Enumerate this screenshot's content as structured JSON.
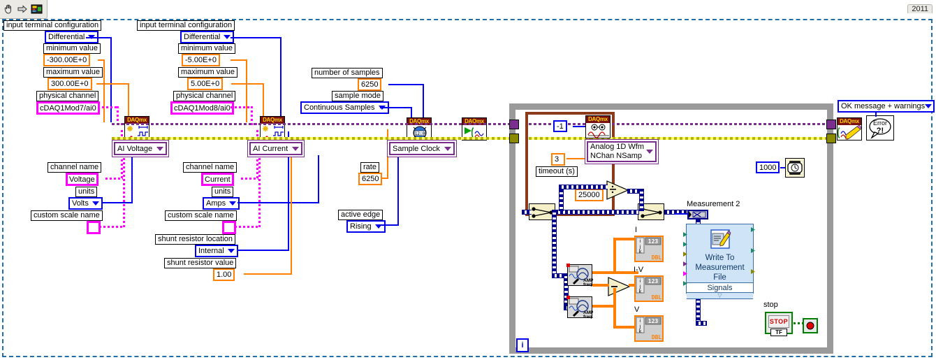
{
  "window": {
    "year_tab": "2011",
    "toolbar_icons": [
      "hand-tool-icon",
      "arrow-tool-icon",
      "block-diagram-icon"
    ]
  },
  "voltage_channel": {
    "terminal_config_label": "input terminal configuration",
    "terminal_config_value": "Differential",
    "min_label": "minimum value",
    "min_value": "-300.00E+0",
    "max_label": "maximum value",
    "max_value": "300.00E+0",
    "physical_channel_label": "physical channel",
    "physical_channel_value": "cDAQ1Mod7/ai0",
    "node_title": "DAQmx",
    "node_selector": "AI Voltage",
    "channel_name_label": "channel name",
    "channel_name_value": "Voltage",
    "units_label": "units",
    "units_value": "Volts",
    "custom_scale_label": "custom scale name",
    "custom_scale_value": ""
  },
  "current_channel": {
    "terminal_config_label": "input terminal configuration",
    "terminal_config_value": "Differential",
    "min_label": "minimum value",
    "min_value": "-5.00E+0",
    "max_label": "maximum value",
    "max_value": "5.00E+0",
    "physical_channel_label": "physical channel",
    "physical_channel_value": "cDAQ1Mod8/ai0",
    "node_title": "DAQmx",
    "node_selector": "AI Current",
    "channel_name_label": "channel name",
    "channel_name_value": "Current",
    "units_label": "units",
    "units_value": "Amps",
    "custom_scale_label": "custom scale name",
    "custom_scale_value": "",
    "shunt_location_label": "shunt resistor location",
    "shunt_location_value": "Internal",
    "shunt_value_label": "shunt resistor value",
    "shunt_value_value": "1.00"
  },
  "timing": {
    "number_of_samples_label": "number of samples",
    "number_of_samples_value": "6250",
    "sample_mode_label": "sample mode",
    "sample_mode_value": "Continuous Samples",
    "node_title": "DAQmx",
    "node_selector": "Sample Clock",
    "rate_label": "rate",
    "rate_value": "6250",
    "active_edge_label": "active edge",
    "active_edge_value": "Rising"
  },
  "start_task": {
    "node_title": "DAQmx"
  },
  "read": {
    "node_title": "DAQmx",
    "samples_value": "-1",
    "timeout_value": "3",
    "timeout_label": "timeout (s)",
    "node_selector_line1": "Analog 1D Wfm",
    "node_selector_line2": "NChan NSamp"
  },
  "loop": {
    "iteration_terminal": "i",
    "divisor_value": "25000",
    "wait_value": "1000",
    "wait_icon": "wait-ms-timer-icon",
    "divide_icon": "divide-operator-icon",
    "subtract_icon": "subtract-operator-icon",
    "merge_icon": "merge-signals-icon",
    "amp_freq_icon": "amplitude-and-levels-icon"
  },
  "indicators": [
    {
      "label": "I",
      "type": "DBL"
    },
    {
      "label": "I-V",
      "type": "DBL"
    },
    {
      "label": "V",
      "type": "DBL"
    }
  ],
  "write_file": {
    "measurement_label": "Measurement 2",
    "title_line1": "Write To",
    "title_line2": "Measurement",
    "title_line3": "File",
    "signals_label": "Signals",
    "icon": "write-to-measurement-file-icon"
  },
  "stop_control": {
    "label": "stop",
    "button_text": "STOP",
    "boolean_type": "TF",
    "led_icon": "stop-led-indicator"
  },
  "cleanup": {
    "node_title": "DAQmx",
    "error_handler_line1": "Error",
    "error_handler_line2": "?!",
    "dialog_type_value": "OK message + warnings"
  }
}
